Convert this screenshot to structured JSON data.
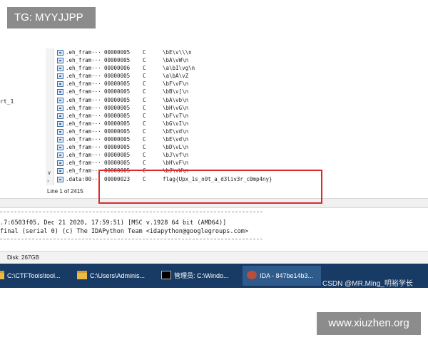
{
  "watermarks": {
    "tg": "TG: MYYJJPP",
    "csdn": "CSDN @MR.Ming_明裕学长",
    "site": "www.xiuzhen.org"
  },
  "left_fragment": "rt_1",
  "strings": {
    "rows": [
      {
        "section": ".eh_fram···",
        "length": "00000005",
        "type": "C",
        "string": "\\bE\\v\\\\\\n"
      },
      {
        "section": ".eh_fram···",
        "length": "00000005",
        "type": "C",
        "string": "\\bA\\vW\\n"
      },
      {
        "section": ".eh_fram···",
        "length": "00000006",
        "type": "C",
        "string": "\\a\\bI\\vg\\n"
      },
      {
        "section": ".eh_fram···",
        "length": "00000005",
        "type": "C",
        "string": "\\a\\bA\\vZ"
      },
      {
        "section": ".eh_fram···",
        "length": "00000005",
        "type": "C",
        "string": "\\bF\\vF\\n"
      },
      {
        "section": ".eh_fram···",
        "length": "00000005",
        "type": "C",
        "string": "\\bB\\v[\\n"
      },
      {
        "section": ".eh_fram···",
        "length": "00000005",
        "type": "C",
        "string": "\\bA\\vb\\n"
      },
      {
        "section": ".eh_fram···",
        "length": "00000005",
        "type": "C",
        "string": "\\bH\\vG\\n"
      },
      {
        "section": ".eh_fram···",
        "length": "00000005",
        "type": "C",
        "string": "\\bF\\vT\\n"
      },
      {
        "section": ".eh_fram···",
        "length": "00000005",
        "type": "C",
        "string": "\\bG\\vI\\n"
      },
      {
        "section": ".eh_fram···",
        "length": "00000005",
        "type": "C",
        "string": "\\bE\\vd\\n"
      },
      {
        "section": ".eh_fram···",
        "length": "00000005",
        "type": "C",
        "string": "\\bE\\vd\\n"
      },
      {
        "section": ".eh_fram···",
        "length": "00000005",
        "type": "C",
        "string": "\\bD\\vL\\n"
      },
      {
        "section": ".eh_fram···",
        "length": "00000005",
        "type": "C",
        "string": "\\bJ\\vf\\n"
      },
      {
        "section": ".eh_fram···",
        "length": "00000005",
        "type": "C",
        "string": "\\bH\\vF\\n"
      },
      {
        "section": ".eh_fram···",
        "length": "00000005",
        "type": "C",
        "string": "\\bJ\\vW\\n"
      },
      {
        "section": ".data:00···",
        "length": "00000023",
        "type": "C",
        "string": "flag{Upx_1s_n0t_a_d3liv3r_c0mp4ny}"
      }
    ],
    "status": "Line 1 of 2415"
  },
  "output": {
    "lines": [
      ".7:6503f05, Dec 21 2020, 17:59:51) [MSC v.1928 64 bit (AMD64)]",
      " final (serial 0) (c) The IDAPython Team <idapython@googlegroups.com>"
    ]
  },
  "disk": "Disk: 267GB",
  "taskbar": {
    "items": [
      {
        "label": "C:\\CTFTools\\tool..."
      },
      {
        "label": "C:\\Users\\Adminis..."
      },
      {
        "label": "管理员: C:\\Windo..."
      },
      {
        "label": "IDA - 847be14b3..."
      }
    ]
  },
  "colors": {
    "highlight_box": "#dd2a2a",
    "taskbar": "#183b66"
  }
}
